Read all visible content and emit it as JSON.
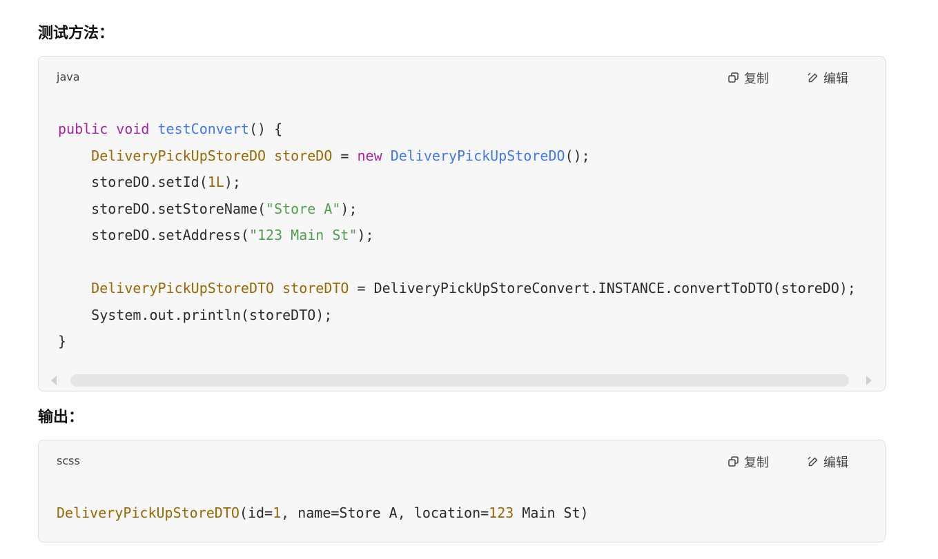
{
  "sections": [
    {
      "heading": "测试方法：",
      "block": {
        "language": "java",
        "copy_label": "复制",
        "edit_label": "编辑",
        "lines": [
          [
            {
              "t": "public",
              "c": "kw"
            },
            {
              "t": " "
            },
            {
              "t": "void",
              "c": "kw"
            },
            {
              "t": " "
            },
            {
              "t": "testConvert",
              "c": "fn"
            },
            {
              "t": "() {"
            }
          ],
          [
            {
              "t": "    "
            },
            {
              "t": "DeliveryPickUpStoreDO",
              "c": "ty"
            },
            {
              "t": " "
            },
            {
              "t": "storeDO",
              "c": "ty"
            },
            {
              "t": " = "
            },
            {
              "t": "new",
              "c": "kw"
            },
            {
              "t": " "
            },
            {
              "t": "DeliveryPickUpStoreDO",
              "c": "fn"
            },
            {
              "t": "();"
            }
          ],
          [
            {
              "t": "    storeDO.setId("
            },
            {
              "t": "1L",
              "c": "num"
            },
            {
              "t": ");"
            }
          ],
          [
            {
              "t": "    storeDO.setStoreName("
            },
            {
              "t": "\"Store A\"",
              "c": "str"
            },
            {
              "t": ");"
            }
          ],
          [
            {
              "t": "    storeDO.setAddress("
            },
            {
              "t": "\"123 Main St\"",
              "c": "str"
            },
            {
              "t": ");"
            }
          ],
          [
            {
              "t": ""
            }
          ],
          [
            {
              "t": "    "
            },
            {
              "t": "DeliveryPickUpStoreDTO",
              "c": "ty"
            },
            {
              "t": " "
            },
            {
              "t": "storeDTO",
              "c": "ty"
            },
            {
              "t": " = DeliveryPickUpStoreConvert.INSTANCE.convertToDTO(storeDO);"
            }
          ],
          [
            {
              "t": "    System.out.println(storeDTO);"
            }
          ],
          [
            {
              "t": "}"
            }
          ]
        ]
      }
    },
    {
      "heading": "输出：",
      "block": {
        "language": "scss",
        "copy_label": "复制",
        "edit_label": "编辑",
        "lines": [
          [
            {
              "t": "DeliveryPickUpStoreDTO",
              "c": "ty"
            },
            {
              "t": "(id="
            },
            {
              "t": "1",
              "c": "num"
            },
            {
              "t": ", name=Store A, location="
            },
            {
              "t": "123",
              "c": "num"
            },
            {
              "t": " Main St)"
            }
          ]
        ]
      }
    }
  ],
  "icons": {
    "copy": "copy-icon",
    "edit": "edit-pencil-icon"
  }
}
